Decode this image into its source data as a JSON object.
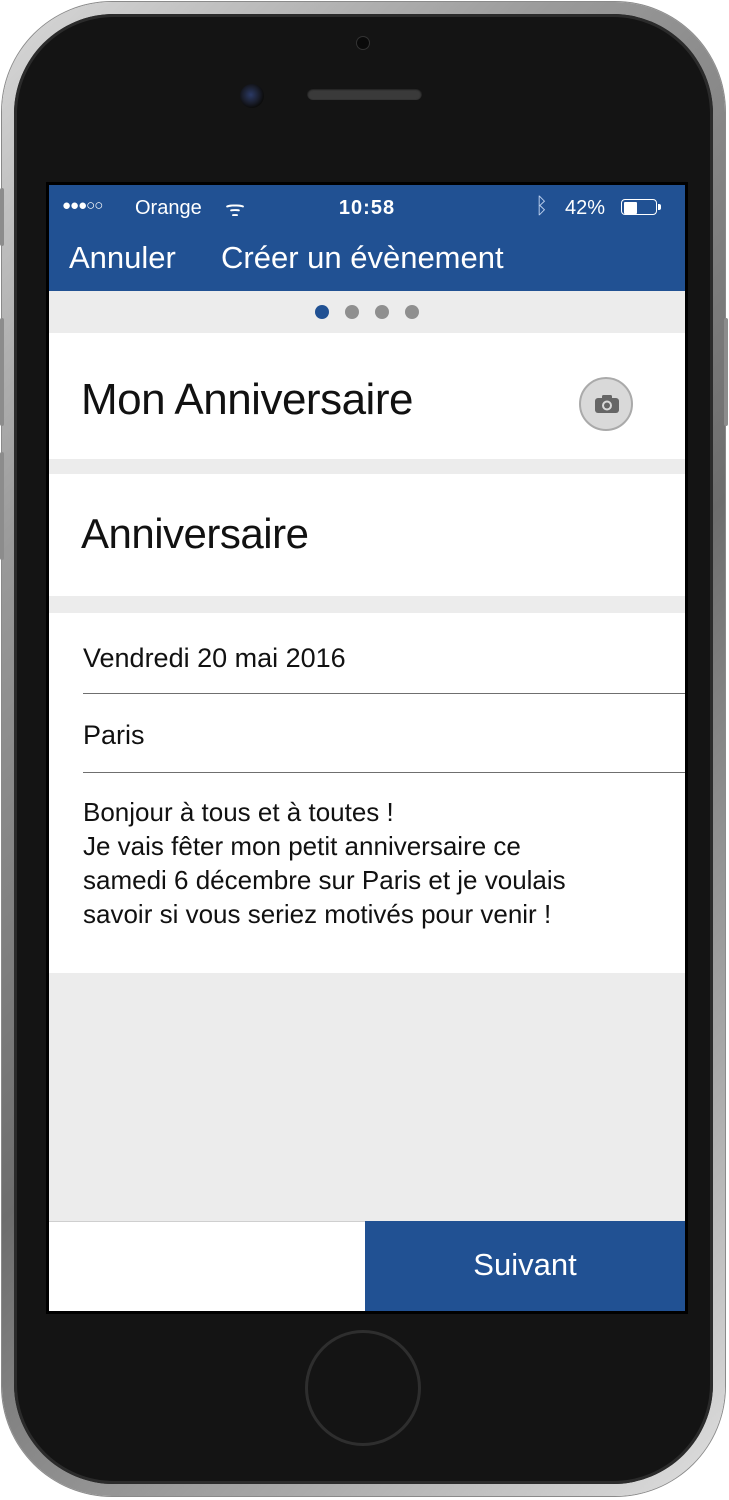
{
  "status_bar": {
    "signal": "●●●○○",
    "carrier": "Orange",
    "wifi_icon": "wifi-icon",
    "time": "10:58",
    "bluetooth_icon": "bluetooth-icon",
    "battery_percent": "42%",
    "battery_level": 0.42
  },
  "nav": {
    "cancel_label": "Annuler",
    "title": "Créer un évènement"
  },
  "pager": {
    "total_pages": 4,
    "current_page": 1
  },
  "event": {
    "name": "Mon Anniversaire",
    "type": "Anniversaire",
    "date": "Vendredi 20 mai 2016",
    "place": "Paris",
    "description_lines": [
      "Bonjour à tous et à toutes !",
      "Je vais fêter mon petit anniversaire ce",
      "samedi 6 décembre sur Paris et je voulais",
      "savoir si vous seriez motivés pour venir !"
    ]
  },
  "footer": {
    "next_label": "Suivant"
  },
  "colors": {
    "brand_blue": "#215193",
    "background_gray": "#ececec"
  }
}
